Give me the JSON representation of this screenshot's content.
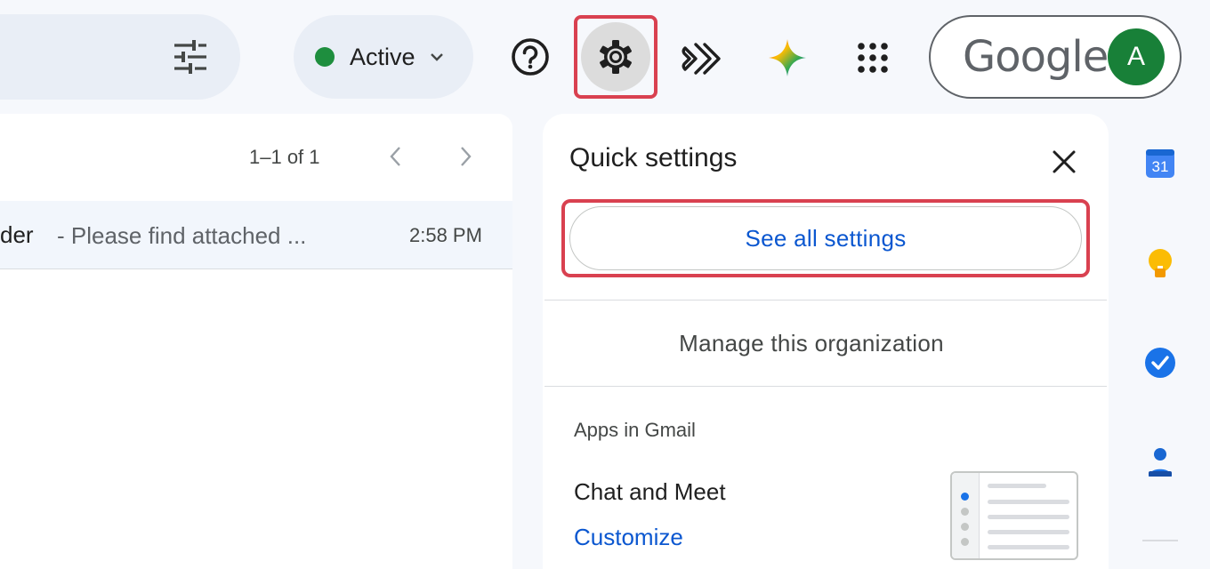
{
  "topbar": {
    "status": {
      "label": "Active",
      "color": "#1e8e3e"
    },
    "account": {
      "brand": "Google",
      "avatar_initial": "A",
      "avatar_color": "#188038"
    },
    "icons": [
      "tune-icon",
      "help-icon",
      "settings-icon",
      "extension-icon",
      "gemini-icon",
      "apps-grid-icon"
    ]
  },
  "mail_list": {
    "pagination": "1–1 of 1",
    "rows": [
      {
        "sender": "der",
        "snippet": "- Please find attached ...",
        "time": "2:58 PM"
      }
    ]
  },
  "quick_settings": {
    "title": "Quick settings",
    "see_all": "See all settings",
    "manage_org": "Manage this organization",
    "apps_heading": "Apps in Gmail",
    "chat_meet": "Chat and Meet",
    "customize": "Customize"
  },
  "side_panel": {
    "apps": [
      "calendar-icon",
      "keep-icon",
      "tasks-icon",
      "contacts-icon"
    ],
    "calendar_day": "31"
  },
  "colors": {
    "highlight": "#d94150",
    "link": "#0b57d0",
    "background": "#f6f8fc"
  }
}
